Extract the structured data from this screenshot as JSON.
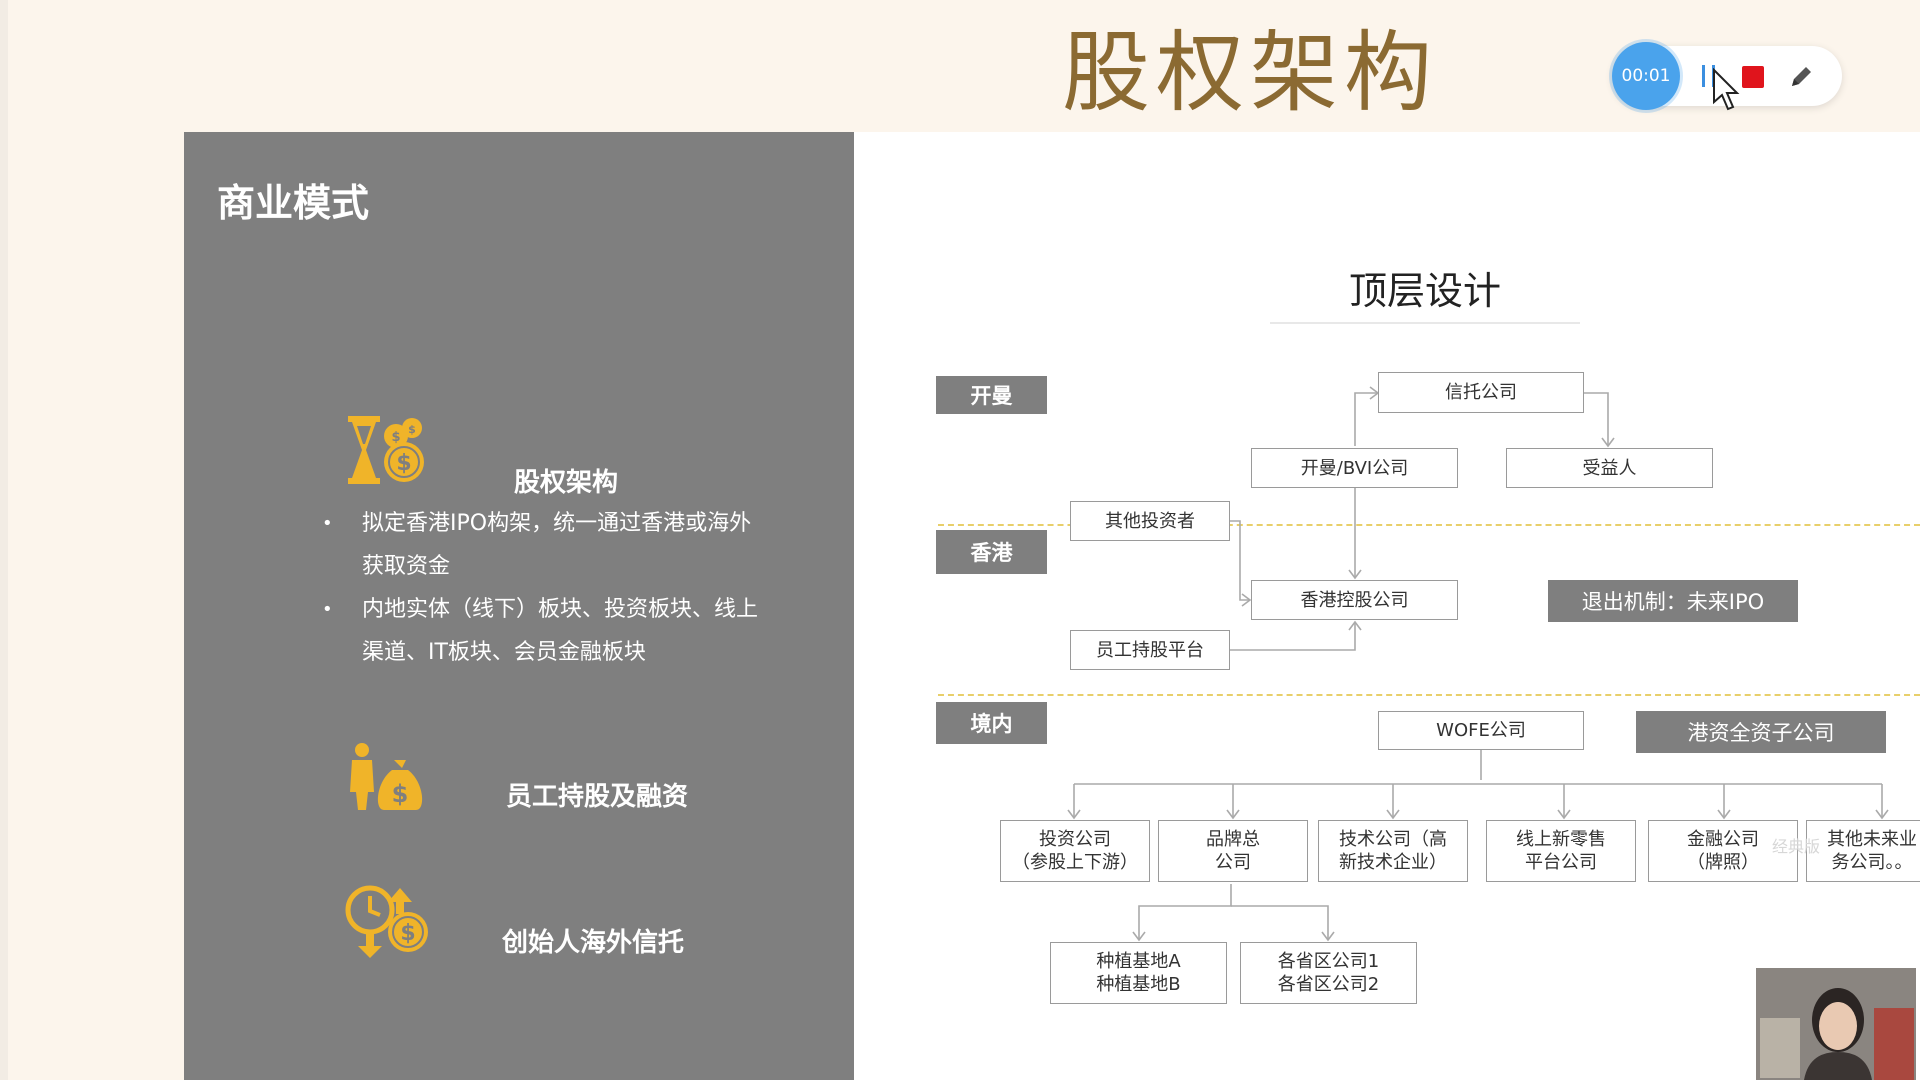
{
  "slide": {
    "title": "股权架构"
  },
  "recorder": {
    "timer": "00:01"
  },
  "left_panel": {
    "title": "商业模式",
    "sections": [
      {
        "icon": "hourglass-money-icon",
        "title": "股权架构",
        "bullets": [
          "拟定香港IPO构架，统一通过香港或海外获取资金",
          "内地实体（线下）板块、投资板块、线上渠道、IT板块、会员金融板块"
        ]
      },
      {
        "icon": "person-moneybag-icon",
        "title": "员工持股及融资"
      },
      {
        "icon": "clock-money-icon",
        "title": "创始人海外信托"
      }
    ]
  },
  "diagram": {
    "title": "顶层设计",
    "regions": [
      "开曼",
      "香港",
      "境内"
    ],
    "nodes": {
      "trust": "信托公司",
      "cayman_bvi": "开曼/BVI公司",
      "beneficiary": "受益人",
      "other_investors": "其他投资者",
      "hk_holding": "香港控股公司",
      "esop_platform": "员工持股平台",
      "exit": "退出机制：未来IPO",
      "wofe": "WOFE公司",
      "hk_subsidiary": "港资全资子公司",
      "invest_co": "投资公司\n（参股上下游）",
      "brand_co": "品牌总\n公司",
      "tech_co": "技术公司（高\n新技术企业）",
      "online_retail": "线上新零售\n平台公司",
      "finance_co": "金融公司\n（牌照）",
      "future_co": "其他未来业\n务公司。。",
      "planting_base": "种植基地A\n种植基地B",
      "province_co": "各省区公司1\n各省区公司2"
    },
    "watermark": "经典版"
  },
  "colors": {
    "background": "#fcf5ec",
    "panel_gray": "#7f7f7f",
    "title_gold": "#8b6a32",
    "icon_gold": "#f0b429",
    "recorder_blue": "#4aa3ec",
    "stop_red": "#e0141c"
  }
}
